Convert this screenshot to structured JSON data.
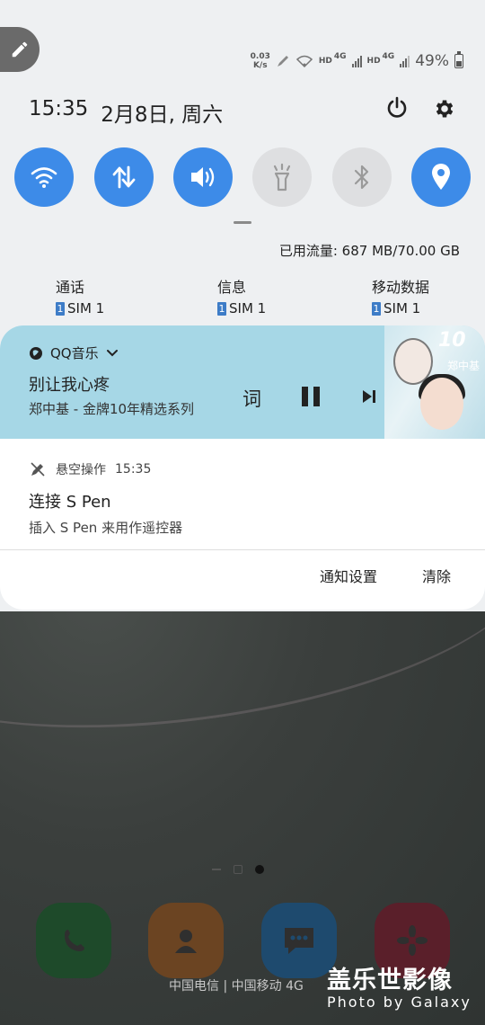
{
  "status_bar": {
    "net_speed_value": "0.03",
    "net_speed_unit": "K/s",
    "sim1_label": "HD",
    "sim1_network": "4G",
    "sim2_label": "HD",
    "sim2_network": "4G",
    "battery_percent": "49%"
  },
  "header": {
    "time": "15:35",
    "date": "2月8日, 周六"
  },
  "quick_toggles": [
    {
      "name": "wifi",
      "icon": "wifi-icon",
      "state": "on"
    },
    {
      "name": "mobile-data",
      "icon": "data-arrows-icon",
      "state": "on"
    },
    {
      "name": "sound",
      "icon": "speaker-icon",
      "state": "on"
    },
    {
      "name": "flashlight",
      "icon": "flashlight-icon",
      "state": "off"
    },
    {
      "name": "bluetooth",
      "icon": "bluetooth-icon",
      "state": "off"
    },
    {
      "name": "location",
      "icon": "location-pin-icon",
      "state": "on"
    }
  ],
  "data_usage": "已用流量: 687 MB/70.00 GB",
  "sim_prefs": [
    {
      "label": "通话",
      "slot": "1",
      "sim": "SIM 1"
    },
    {
      "label": "信息",
      "slot": "1",
      "sim": "SIM 1"
    },
    {
      "label": "移动数据",
      "slot": "1",
      "sim": "SIM 1"
    }
  ],
  "media": {
    "app_name": "QQ音乐",
    "song": "别让我心疼",
    "album": "郑中基 - 金牌10年精选系列",
    "lyrics_label": "词",
    "cover_logo": "10",
    "cover_artist": "郑中基"
  },
  "notification": {
    "app_name": "悬空操作",
    "time": "15:35",
    "title": "连接 S Pen",
    "body": "插入 S Pen 来用作遥控器"
  },
  "actions": {
    "settings_label": "通知设置",
    "clear_label": "清除"
  },
  "bottom": {
    "carrier": "中国电信 | 中国移动 4G"
  },
  "watermark": {
    "title": "盖乐世影像",
    "subtitle": "Photo by Galaxy"
  },
  "colors": {
    "accent": "#3d8be8",
    "media_bg": "#a6d7e6"
  }
}
